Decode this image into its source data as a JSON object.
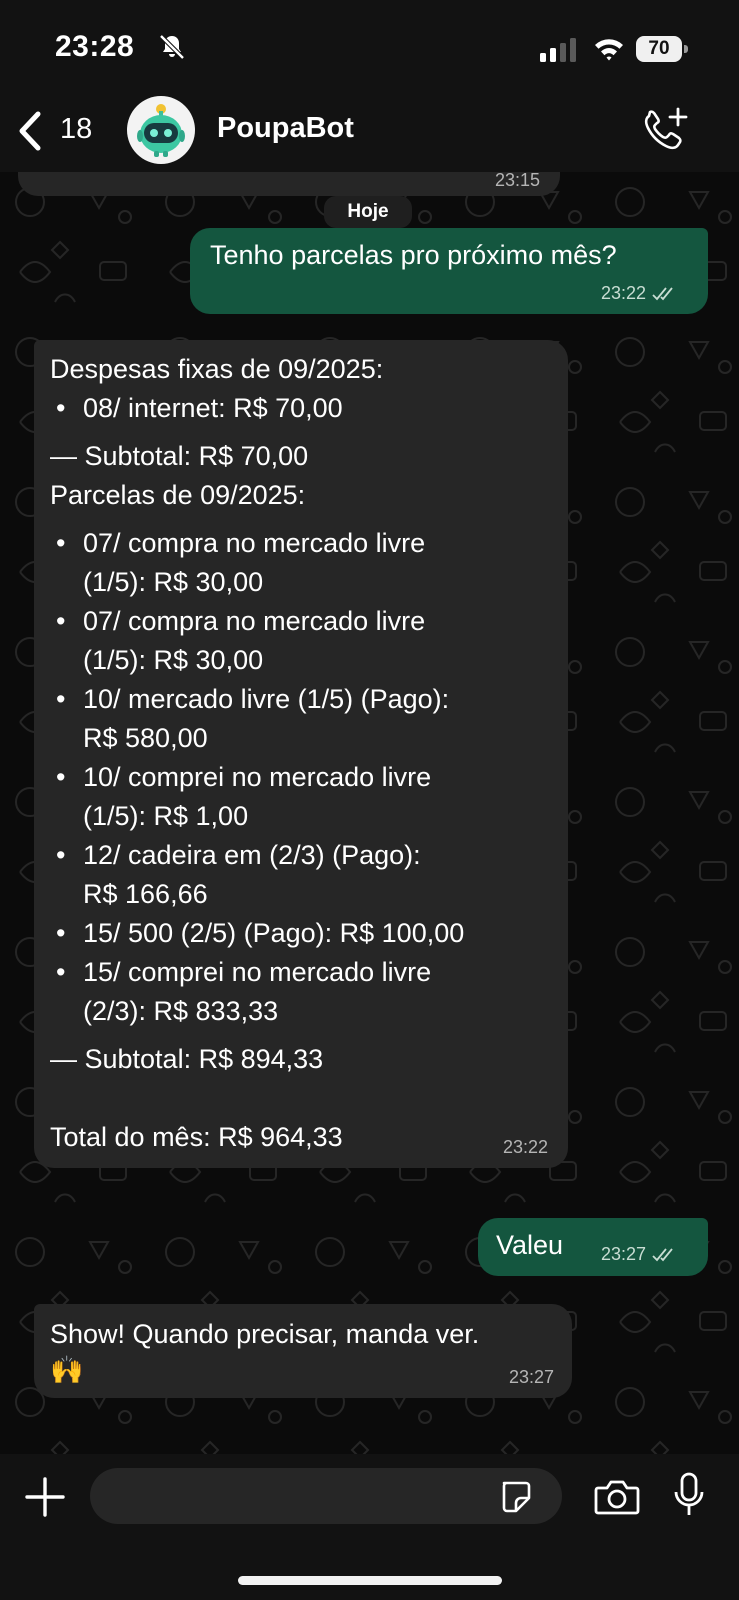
{
  "status_bar": {
    "time": "23:28",
    "battery": "70"
  },
  "header": {
    "back_count": "18",
    "contact_name": "PoupaBot"
  },
  "chat": {
    "previous_time": "23:15",
    "date_separator": "Hoje",
    "messages": [
      {
        "direction": "outgoing",
        "text": "Tenho parcelas pro próximo mês?",
        "time": "23:22",
        "status": "read"
      },
      {
        "direction": "incoming",
        "time": "23:22",
        "lines": [
          "Despesas fixas de 09/2025:",
          "08/   internet: R$ 70,00",
          "— Subtotal: R$ 70,00",
          "Parcelas de 09/2025:",
          "07/   compra no mercado livre",
          "(1/5): R$ 30,00",
          "07/   compra no mercado livre",
          "(1/5): R$ 30,00",
          "10/   mercado livre (1/5) (Pago):",
          "R$ 580,00",
          "10/   comprei no mercado livre",
          "(1/5): R$ 1,00",
          "12/   cadeira em (2/3) (Pago):",
          "R$ 166,66",
          "15/   500 (2/5) (Pago): R$ 100,00",
          "15/   comprei no mercado livre",
          "(2/3): R$ 833,33",
          "— Subtotal: R$ 894,33",
          "Total do mês: R$ 964,33"
        ]
      },
      {
        "direction": "outgoing",
        "text": "Valeu",
        "time": "23:27",
        "status": "read"
      },
      {
        "direction": "incoming",
        "text": "Show! Quando precisar, manda ver.",
        "emoji": "🙌",
        "time": "23:27"
      }
    ]
  },
  "colors": {
    "outgoing_bubble": "#14563f",
    "incoming_bubble": "#262626",
    "background": "#0b0b0b"
  },
  "icons": [
    "back-chevron-icon",
    "bell-slash-icon",
    "signal-icon",
    "wifi-icon",
    "battery-icon",
    "call-add-icon",
    "plus-icon",
    "sticker-icon",
    "camera-icon",
    "microphone-icon",
    "read-receipt-icon"
  ]
}
